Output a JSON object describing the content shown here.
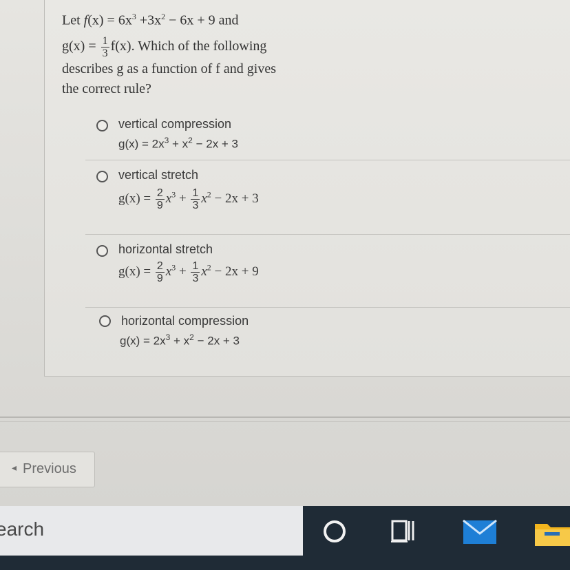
{
  "question": {
    "line1_prefix": "Let ",
    "line1_f": "f",
    "line1_args": "(x) = 6x",
    "line1_exp3": "3",
    "line1_mid": " +3x",
    "line1_exp2": "2",
    "line1_rest": " − 6x + 9 and",
    "line2_g": "g(x) = ",
    "frac_num": "1",
    "frac_den": "3",
    "line2_rest": "f(x). Which of the following",
    "line3": "describes g as a function of f and gives",
    "line4": "the correct rule?"
  },
  "options": [
    {
      "label": "vertical compression",
      "formula": {
        "a": "g(x) = 2x",
        "e1": "3",
        "b": " + x",
        "e2": "2",
        "c": " − 2x + 3"
      }
    },
    {
      "label": "vertical stretch",
      "formula": {
        "g": "g(x) = ",
        "n1": "2",
        "d1": "9",
        "x1": "x",
        "e1": "3",
        "plus": " + ",
        "n2": "1",
        "d2": "3",
        "x2": "x",
        "e2": "2",
        "tail": " − 2x + 3"
      }
    },
    {
      "label": "horizontal stretch",
      "formula": {
        "g": "g(x) = ",
        "n1": "2",
        "d1": "9",
        "x1": "x",
        "e1": "3",
        "plus": " + ",
        "n2": "1",
        "d2": "3",
        "x2": "x",
        "e2": "2",
        "tail": " − 2x + 9"
      }
    },
    {
      "label": "horizontal compression",
      "formula": {
        "a": "g(x) = 2x",
        "e1": "3",
        "b": " + x",
        "e2": "2",
        "c": " − 2x + 3"
      }
    }
  ],
  "nav": {
    "previous_label": "Previous",
    "previous_arrow": "◂"
  },
  "taskbar": {
    "search_text": "earch",
    "icons": [
      "cortana-icon",
      "task-view-icon",
      "mail-icon",
      "file-explorer-icon"
    ],
    "colors": {
      "background": "#1f2b36",
      "mail": "#1e7fd6",
      "folder": "#f2b51e"
    }
  }
}
